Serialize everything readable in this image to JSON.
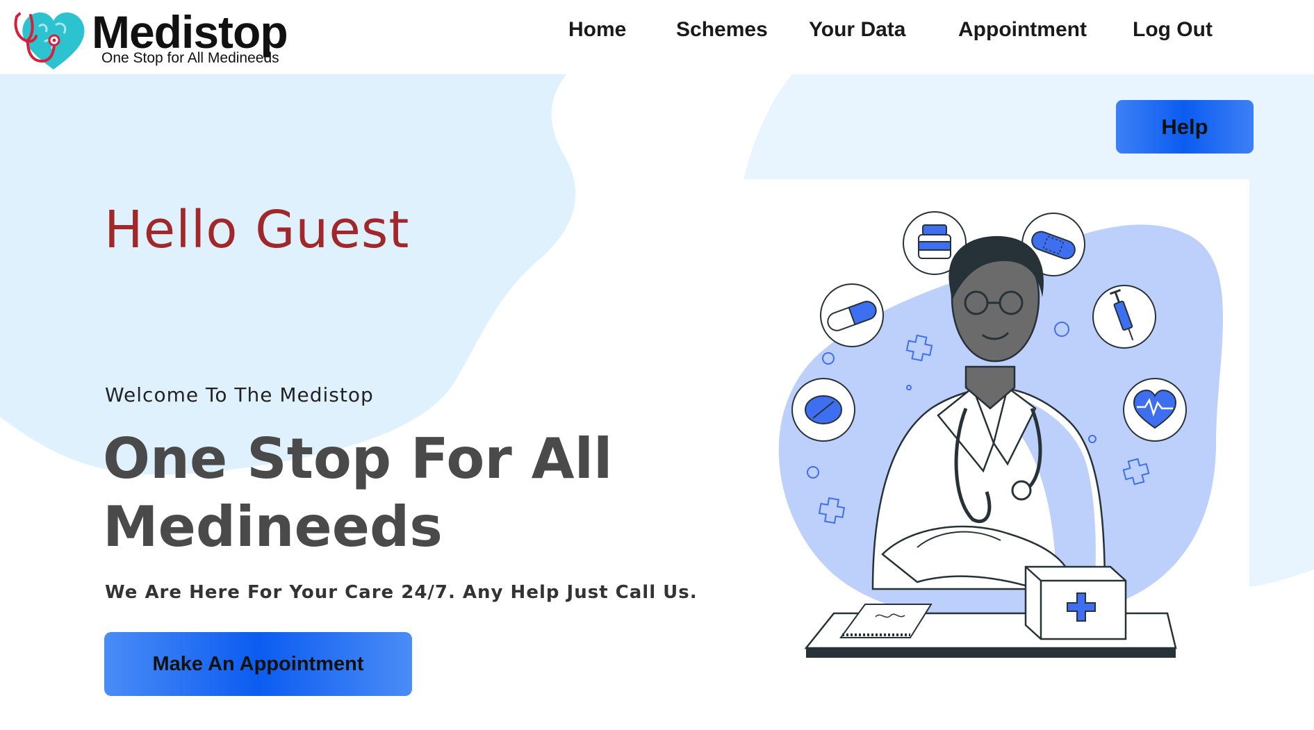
{
  "brand": {
    "name": "Medistop",
    "tagline": "One Stop for All Medineeds"
  },
  "nav": {
    "items": [
      {
        "label": "Home"
      },
      {
        "label": "Schemes"
      },
      {
        "label": "Your Data"
      },
      {
        "label": "Appointment"
      },
      {
        "label": "Log Out"
      }
    ]
  },
  "help_button": {
    "label": "Help"
  },
  "hero": {
    "greeting": "Hello Guest",
    "welcome": "Welcome To The Medistop",
    "headline": "One Stop For All Medineeds",
    "subline": "We Are Here For Your Care 24/7. Any Help Just Call Us.",
    "cta_label": "Make An Appointment"
  },
  "colors": {
    "greeting": "#a0282a",
    "button_blue": "#0b5cf0",
    "blob_light_blue": "#dff1fd",
    "illustration_blob": "#bcd0fb",
    "logo_teal": "#2dc2cf",
    "logo_red": "#d81f3a"
  },
  "icons": {
    "logo": "stethoscope-heart-icon",
    "illustration": "doctor-illustration"
  }
}
